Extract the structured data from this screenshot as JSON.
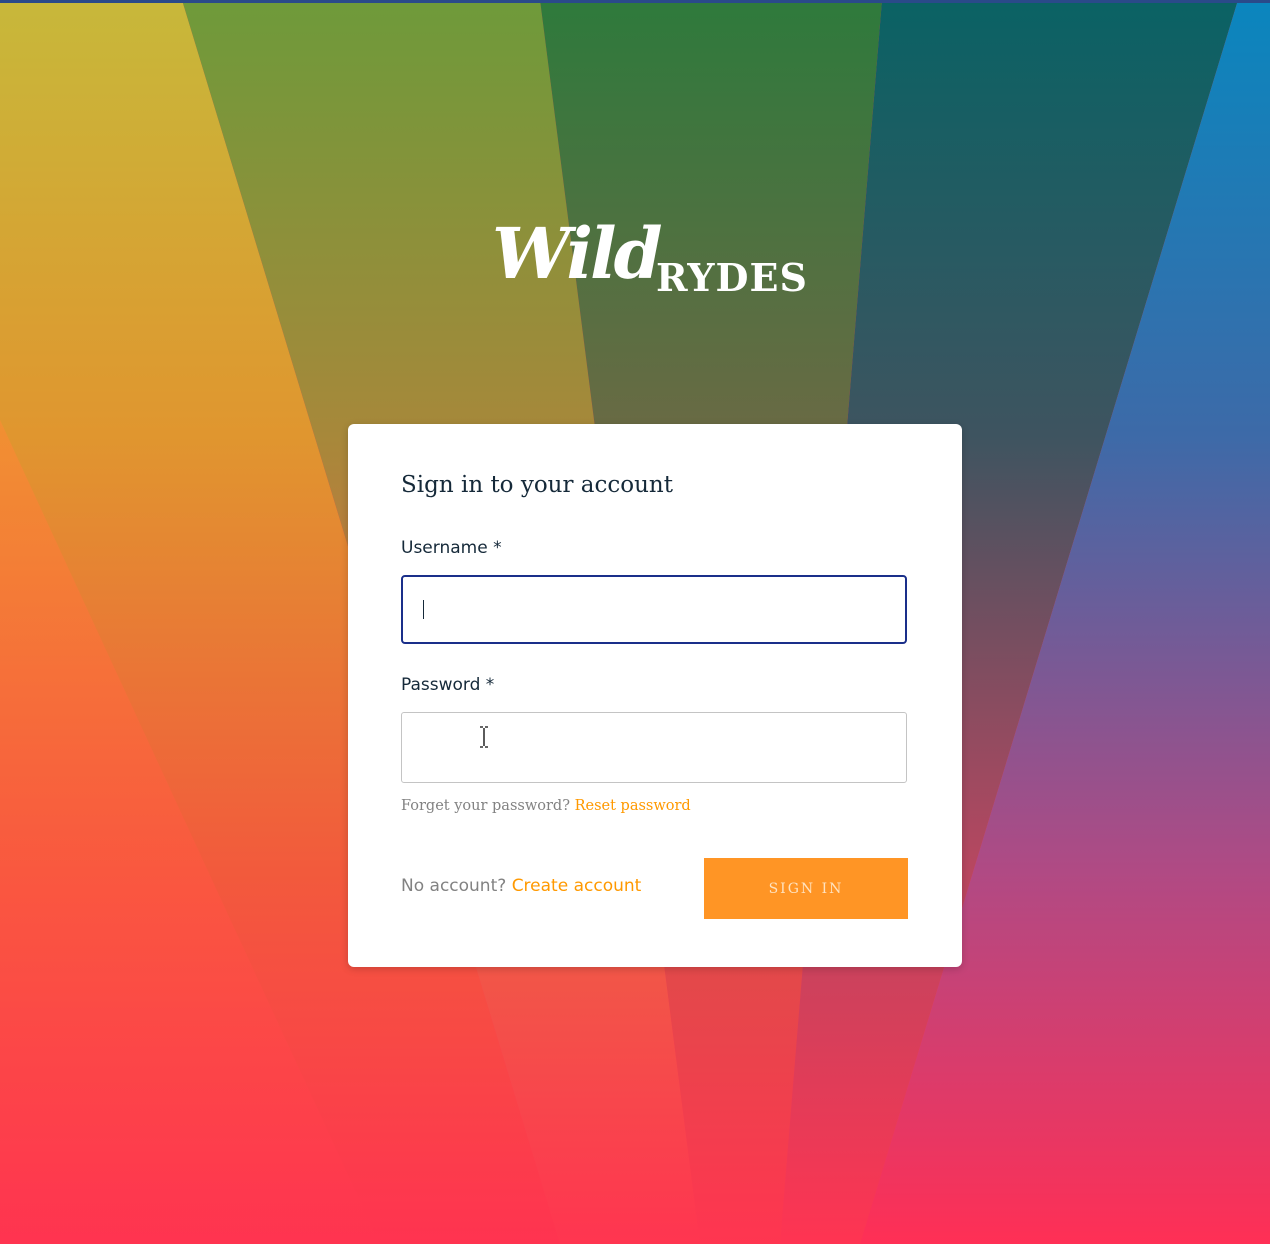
{
  "logo": {
    "script_text": "Wild",
    "caps_text": "RYDES"
  },
  "signin_form": {
    "title": "Sign in to your account",
    "username_label": "Username *",
    "username_value": "",
    "password_label": "Password *",
    "password_value": "",
    "forgot_text": "Forget your password?",
    "reset_link": "Reset password",
    "no_account_text": "No account?",
    "create_account_link": "Create account",
    "submit_label": "SIGN IN"
  },
  "colors": {
    "accent": "#ff9900",
    "button_bg": "#ff9525",
    "focus_border": "#1a2f8a",
    "text": "#152939",
    "muted_text": "#828282"
  },
  "icons": {
    "cursor": "text-cursor-icon"
  }
}
